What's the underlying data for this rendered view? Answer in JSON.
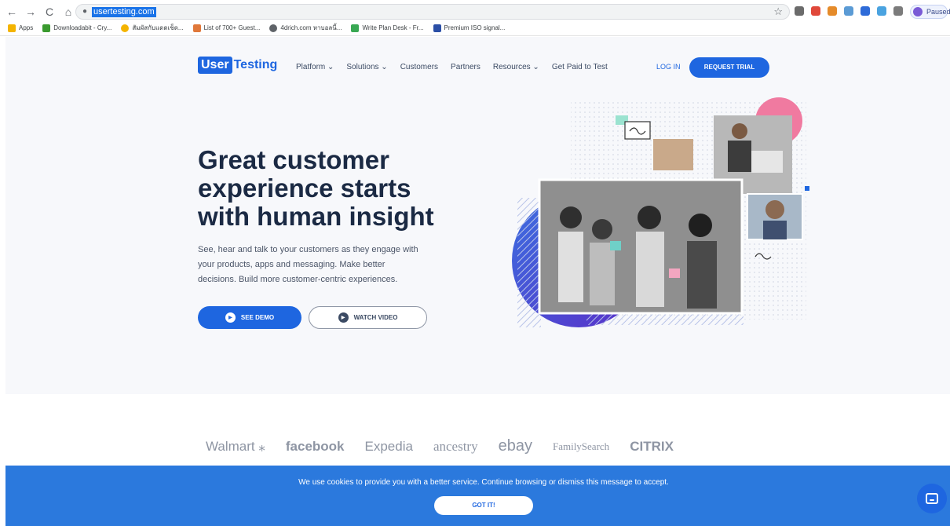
{
  "browser": {
    "nav": {
      "back": "←",
      "forward": "→",
      "reload": "C",
      "home": "⌂"
    },
    "url": "usertesting.com",
    "profile_status": "Paused",
    "bookmarks": [
      {
        "label": "Apps",
        "color": "#f4b400"
      },
      {
        "label": "Downloadabit - Cry...",
        "color": "#3a9a2f"
      },
      {
        "label": "สัมผัสกับแดดเช็ด...",
        "color": "#f4b400"
      },
      {
        "label": "List of 700+ Guest...",
        "color": "#e0783a"
      },
      {
        "label": "4drich.com หาบอลนี้...",
        "color": "#5f6368"
      },
      {
        "label": "Write Plan Desk - Fr...",
        "color": "#39a853"
      },
      {
        "label": "Premium ISO signal...",
        "color": "#2b4fa6"
      }
    ]
  },
  "header": {
    "logo_user": "User",
    "logo_testing": "Testing",
    "menu": [
      "Platform ⌄",
      "Solutions ⌄",
      "Customers",
      "Partners",
      "Resources ⌄",
      "Get Paid to Test"
    ],
    "login": "LOG IN",
    "request_trial": "REQUEST TRIAL"
  },
  "hero": {
    "headline": "Great customer experience starts with human insight",
    "subtext": "See, hear and talk to your customers as they engage with your products, apps and messaging. Make better decisions. Build more customer-centric experiences.",
    "see_demo": "SEE DEMO",
    "watch_video": "WATCH VIDEO"
  },
  "logos": [
    "Walmart ⁎",
    "facebook",
    "Expedia",
    "ancestry",
    "ebay",
    "FamilySearch",
    "CITRIX"
  ],
  "cookie": {
    "text": "We use cookies to provide you with a better service. Continue browsing or dismiss this message to accept.",
    "button": "GOT IT!"
  }
}
